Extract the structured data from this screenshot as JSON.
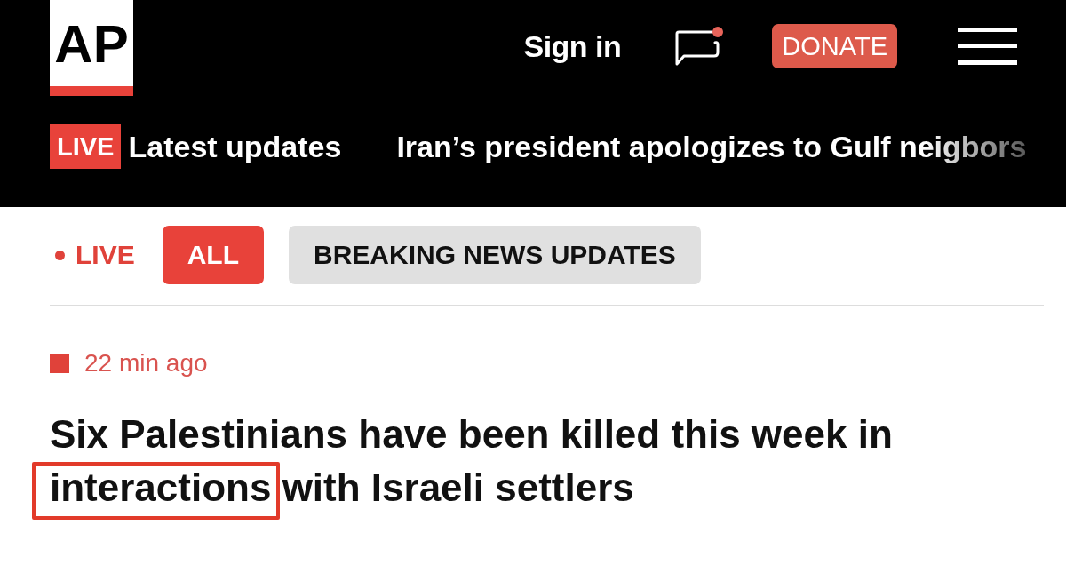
{
  "header": {
    "logo": "AP",
    "sign_in": "Sign in",
    "messages": {
      "unread": true
    },
    "donate": "DONATE"
  },
  "ticker": {
    "badge": "LIVE",
    "label": "Latest updates",
    "headline": "Iran’s president apologizes to Gulf neigbors"
  },
  "filters": {
    "live_label": "LIVE",
    "tabs": [
      {
        "label": "ALL",
        "selected": true
      },
      {
        "label": "BREAKING NEWS UPDATES",
        "selected": false
      }
    ]
  },
  "updates": [
    {
      "time": "22 min ago",
      "headline": [
        {
          "kind": "plain",
          "text": "Six Palestinians have been killed this week in"
        },
        {
          "kind": "circled",
          "text": "interactions"
        },
        {
          "kind": "plain",
          "text": "with Israeli settlers"
        }
      ]
    }
  ]
}
